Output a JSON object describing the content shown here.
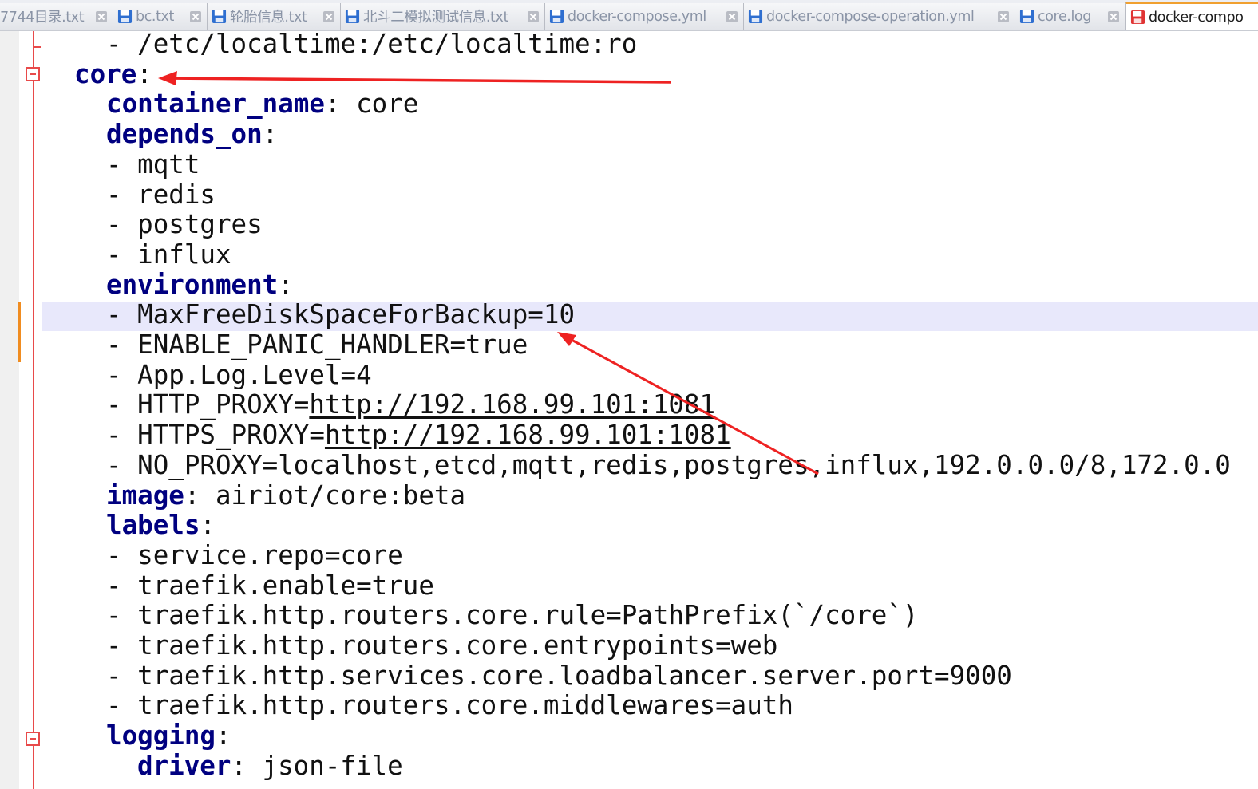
{
  "tabs": [
    {
      "label": "7744目录.txt",
      "saved": true,
      "active": false
    },
    {
      "label": "bc.txt",
      "saved": true,
      "active": false
    },
    {
      "label": "轮胎信息.txt",
      "saved": true,
      "active": false
    },
    {
      "label": "北斗二模拟测试信息.txt",
      "saved": true,
      "active": false
    },
    {
      "label": "docker-compose.yml",
      "saved": true,
      "active": false
    },
    {
      "label": "docker-compose-operation.yml",
      "saved": true,
      "active": false
    },
    {
      "label": "core.log",
      "saved": true,
      "active": false
    },
    {
      "label": "docker-compo",
      "saved": false,
      "active": true
    }
  ],
  "code": {
    "lines": [
      {
        "indent": "  ",
        "dash": "- ",
        "value": "/etc/localtime:/etc/localtime:ro"
      },
      {
        "indent": "",
        "key": "core",
        "colon": ":"
      },
      {
        "indent": "  ",
        "key": "container_name",
        "colon": ": ",
        "value": "core"
      },
      {
        "indent": "  ",
        "key": "depends_on",
        "colon": ":"
      },
      {
        "indent": "  ",
        "dash": "- ",
        "value": "mqtt"
      },
      {
        "indent": "  ",
        "dash": "- ",
        "value": "redis"
      },
      {
        "indent": "  ",
        "dash": "- ",
        "value": "postgres"
      },
      {
        "indent": "  ",
        "dash": "- ",
        "value": "influx"
      },
      {
        "indent": "  ",
        "key": "environment",
        "colon": ":"
      },
      {
        "indent": "  ",
        "dash": "- ",
        "value": "MaxFreeDiskSpaceForBackup=10"
      },
      {
        "indent": "  ",
        "dash": "- ",
        "value": "ENABLE_PANIC_HANDLER=true"
      },
      {
        "indent": "  ",
        "dash": "- ",
        "value": "App.Log.Level=4"
      },
      {
        "indent": "  ",
        "dash": "- ",
        "value": "HTTP_PROXY=",
        "url": "http://192.168.99.101:1081"
      },
      {
        "indent": "  ",
        "dash": "- ",
        "value": "HTTPS_PROXY=",
        "url": "http://192.168.99.101:1081"
      },
      {
        "indent": "  ",
        "dash": "- ",
        "value": "NO_PROXY=localhost,etcd,mqtt,redis,postgres,influx,192.0.0.0/8,172.0.0"
      },
      {
        "indent": "  ",
        "key": "image",
        "colon": ": ",
        "value": "airiot/core:beta"
      },
      {
        "indent": "  ",
        "key": "labels",
        "colon": ":"
      },
      {
        "indent": "  ",
        "dash": "- ",
        "value": "service.repo=core"
      },
      {
        "indent": "  ",
        "dash": "- ",
        "value": "traefik.enable=true"
      },
      {
        "indent": "  ",
        "dash": "- ",
        "value": "traefik.http.routers.core.rule=PathPrefix(`/core`)"
      },
      {
        "indent": "  ",
        "dash": "- ",
        "value": "traefik.http.routers.core.entrypoints=web"
      },
      {
        "indent": "  ",
        "dash": "- ",
        "value": "traefik.http.services.core.loadbalancer.server.port=9000"
      },
      {
        "indent": "  ",
        "dash": "- ",
        "value": "traefik.http.routers.core.middlewares=auth"
      },
      {
        "indent": "  ",
        "key": "logging",
        "colon": ":"
      },
      {
        "indent": "    ",
        "key": "driver",
        "colon": ": ",
        "value": "json-file"
      }
    ],
    "highlighted_line": 9,
    "fold_markers_on_lines": [
      1,
      23
    ]
  },
  "colors": {
    "key": "#000080",
    "text": "#111111",
    "current_line": "#e8e8fb",
    "fold": "#e84a4a",
    "change_marker": "#f08c20",
    "arrow": "#ee2222",
    "saved_icon": "#2f6fd0",
    "unsaved_icon": "#e03434"
  }
}
